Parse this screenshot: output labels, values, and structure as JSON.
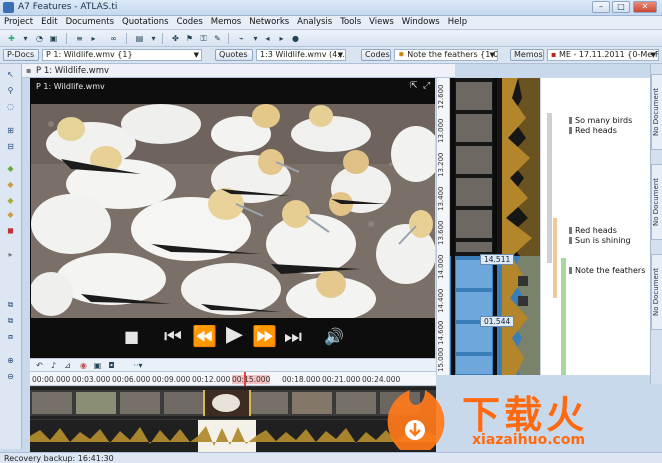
{
  "window": {
    "title": "A7 Features - ATLAS.ti",
    "min": "–",
    "max": "□",
    "close": "✕"
  },
  "menu": [
    "Project",
    "Edit",
    "Documents",
    "Quotations",
    "Codes",
    "Memos",
    "Networks",
    "Analysis",
    "Tools",
    "Views",
    "Windows",
    "Help"
  ],
  "docbar": {
    "pdocs_label": "P-Docs",
    "pdoc_value": "P 1: Wildlife.wmv {1}",
    "quotes_label": "Quotes",
    "quote_value": "1:3 Wildlife.wmv (4...",
    "codes_label": "Codes",
    "code_value": "Note the feathers {1-0",
    "memos_label": "Memos",
    "memo_value": "ME - 17.11.2011 {0-Me-F}"
  },
  "pane": {
    "title": "P 1: Wildlife.wmv"
  },
  "video": {
    "title": "P 1: Wildlife.wmv"
  },
  "ruler_x": [
    "00:00.000",
    "00:03.000",
    "00:06.000",
    "00:09.000",
    "00:12.000",
    "00:15.000",
    "00:18.000",
    "00:21.000",
    "00:24.000"
  ],
  "ruler_y": [
    "12.600",
    "13.000",
    "13.200",
    "13.400",
    "13.600",
    "14.000",
    "14.400",
    "14.600",
    "15.000"
  ],
  "markers": {
    "a": "14.511",
    "b": "01.544"
  },
  "margin_codes": [
    {
      "label": "So many birds",
      "color": "#c8c8d0"
    },
    {
      "label": "Red heads",
      "color": "#c8c8d0"
    },
    {
      "label": "Red heads",
      "color": "#f0c89a"
    },
    {
      "label": "Sun is shining",
      "color": "#f0c89a"
    },
    {
      "label": "Note the feathers",
      "color": "#a8d8a0"
    }
  ],
  "right_tabs": [
    "No Document",
    "No Document",
    "No Document"
  ],
  "status": "Recovery backup: 16:41:30",
  "watermark": {
    "cn": "下载火",
    "url": "xiazaihuo.com"
  },
  "icons": [
    "app-icon",
    "new-icon",
    "open-icon",
    "save-icon",
    "search-icon",
    "pin-icon",
    "expand-icon",
    "fullscreen-icon",
    "stop-icon",
    "prev-icon",
    "rewind-icon",
    "play-icon",
    "forward-icon",
    "next-icon",
    "volume-icon"
  ]
}
